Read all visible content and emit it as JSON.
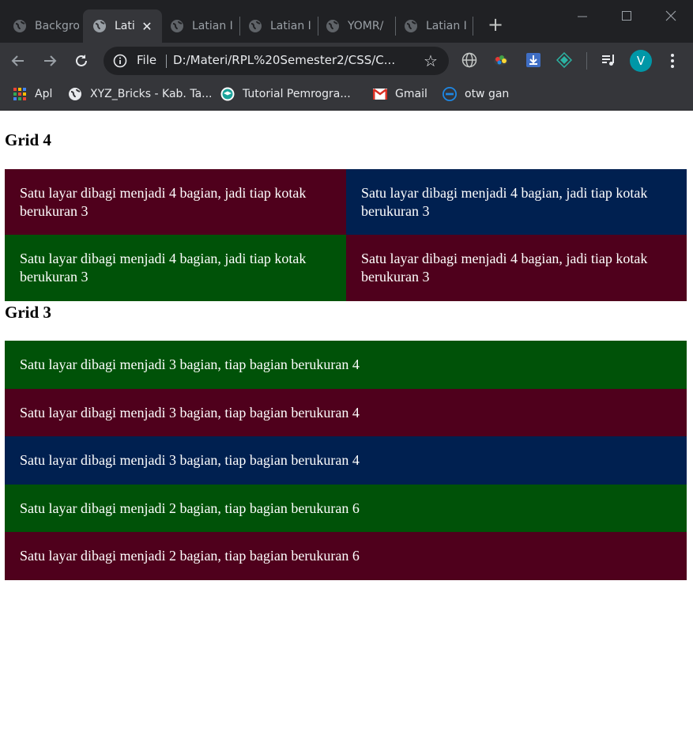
{
  "browser": {
    "tabs": [
      {
        "title": "Backgro",
        "active": false
      },
      {
        "title": "Lati",
        "active": true
      },
      {
        "title": "Latian I",
        "active": false
      },
      {
        "title": "Latian I",
        "active": false
      },
      {
        "title": "YOMR/",
        "active": false
      },
      {
        "title": "Latian I",
        "active": false
      }
    ],
    "omnibox": {
      "scheme_label": "File",
      "url": "D:/Materi/RPL%20Semester2/CSS/C..."
    },
    "profile_initial": "V",
    "bookmarks": [
      {
        "label": "Apl",
        "icon": "apps-grid-icon"
      },
      {
        "label": "XYZ_Bricks - Kab. Ta...",
        "icon": "globe-icon"
      },
      {
        "label": "Tutorial Pemrogra...",
        "icon": "tutorial-site-icon"
      },
      {
        "label": "Gmail",
        "icon": "gmail-icon"
      },
      {
        "label": "otw gan",
        "icon": "dell-icon"
      }
    ]
  },
  "page": {
    "grid4": {
      "heading": "Grid 4",
      "boxes": [
        {
          "text": "Satu layar dibagi menjadi 4 bagian, jadi tiap kotak berukuran 3",
          "color": "#4f001c"
        },
        {
          "text": "Satu layar dibagi menjadi 4 bagian, jadi tiap kotak berukuran 3",
          "color": "#002050"
        },
        {
          "text": "Satu layar dibagi menjadi 4 bagian, jadi tiap kotak berukuran 3",
          "color": "#005208"
        },
        {
          "text": "Satu layar dibagi menjadi 4 bagian, jadi tiap kotak berukuran 3",
          "color": "#4f001c"
        }
      ]
    },
    "grid3": {
      "heading": "Grid 3",
      "rows": [
        {
          "text": "Satu layar dibagi menjadi 3 bagian, tiap bagian berukuran 4",
          "color": "#005208"
        },
        {
          "text": "Satu layar dibagi menjadi 3 bagian, tiap bagian berukuran 4",
          "color": "#4f001c"
        },
        {
          "text": "Satu layar dibagi menjadi 3 bagian, tiap bagian berukuran 4",
          "color": "#002050"
        },
        {
          "text": "Satu layar dibagi menjadi 2 bagian, tiap bagian berukuran 6",
          "color": "#005208"
        },
        {
          "text": "Satu layar dibagi menjadi 2 bagian, tiap bagian berukuran 6",
          "color": "#4f001c"
        }
      ]
    }
  }
}
